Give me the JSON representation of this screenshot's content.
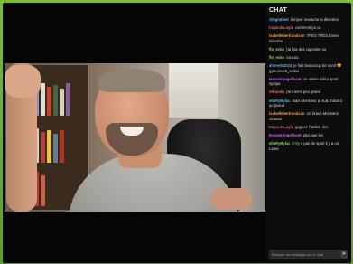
{
  "chat": {
    "title": "CHAT",
    "messages": [
      {
        "user": "@bgtatinet",
        "color": "#5fb0e0",
        "text": "bonjour madame la directrice"
      },
      {
        "user": "CapsuleLayla",
        "color": "#e06a5f",
        "text": "comment ça va"
      },
      {
        "user": "isabellebertrandcsn",
        "color": "#f0a040",
        "text": "TRÈS TRÈS bonne initiative"
      },
      {
        "user": "flo_ecko",
        "color": "#8ecf5a",
        "text": "j'ai fais des capsules ou"
      },
      {
        "user": "flo_ecko",
        "color": "#8ecf5a",
        "text": "coucou"
      },
      {
        "user": "ahmedn2024",
        "color": "#5fb0e0",
        "text": "je fais beaucoup de sport 🧡gym,couck_voilou"
      },
      {
        "user": "lemastrangelfacet",
        "color": "#c46be0",
        "text": "un atelier vidéo sport sympa"
      },
      {
        "user": "Sitrandu",
        "color": "#e06a5f",
        "text": "j'ai mermi peu grand"
      },
      {
        "user": "ellaRyBylac",
        "color": "#5fb0e0",
        "text": "mais Monsieur je suis d'abord un joueur"
      },
      {
        "user": "isabellebertrandcsn",
        "color": "#f0a040",
        "text": "Un bravo Monsieur Girardo"
      },
      {
        "user": "CapsuleLayla",
        "color": "#e06a5f",
        "text": "gagnez l'ombre des"
      },
      {
        "user": "lemastrangelfacet",
        "color": "#c46be0",
        "text": "plus que les"
      },
      {
        "user": "ellaRyBylac",
        "color": "#8ecf5a",
        "text": "il n'y a pas de sport il y a un Lama"
      }
    ],
    "input_placeholder": "Envoyer un message sur le chat",
    "send_icon": "send-icon"
  }
}
